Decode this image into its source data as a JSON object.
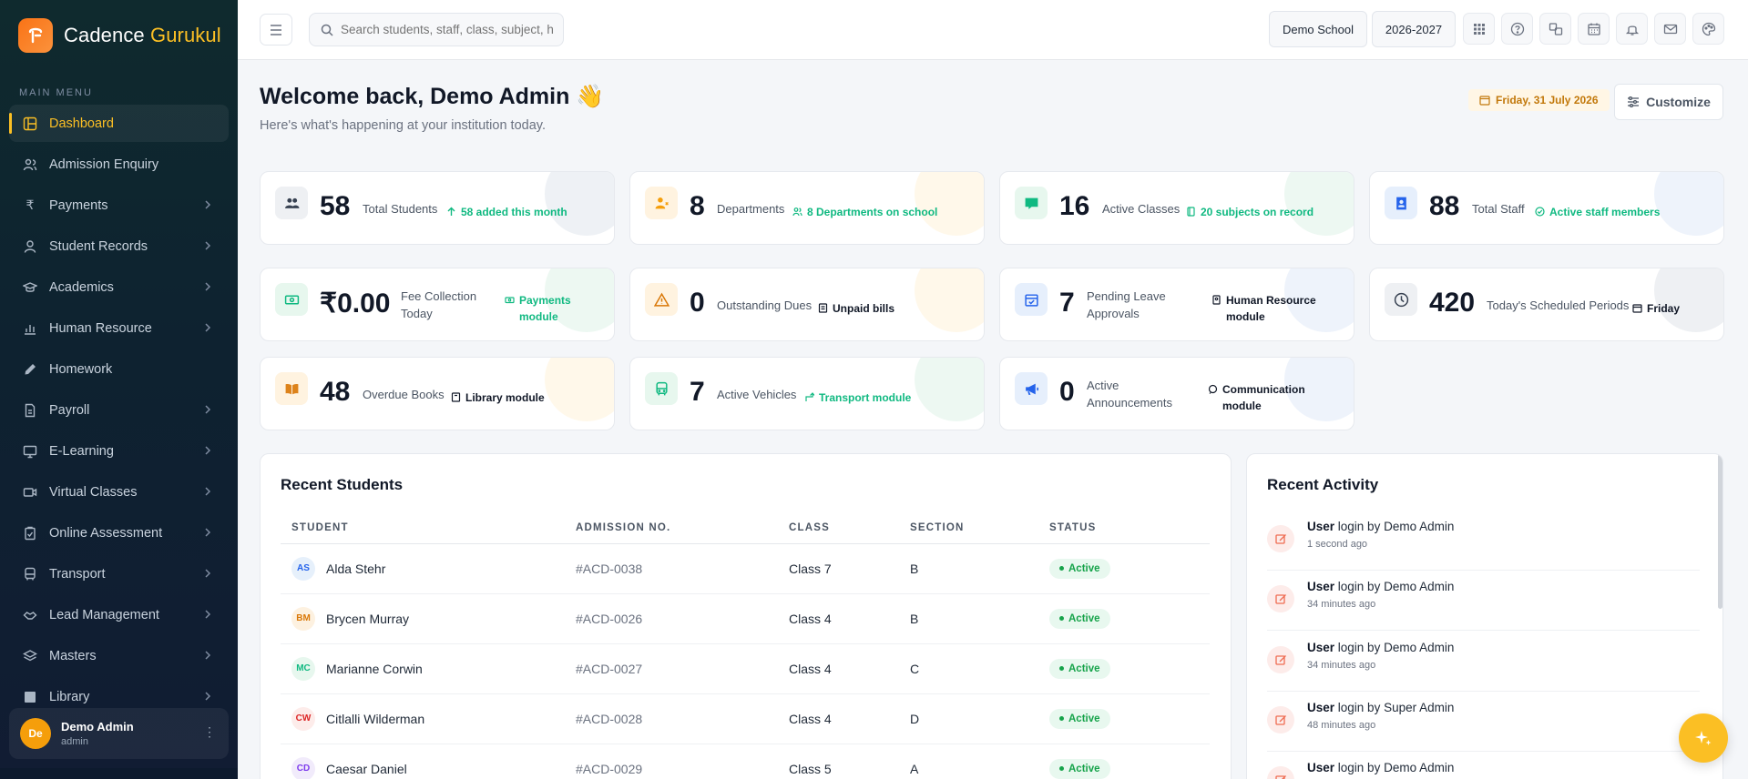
{
  "brand": {
    "name_main": "Cadence",
    "name_accent": "Gurukul"
  },
  "sidebar": {
    "heading": "MAIN MENU",
    "items": [
      {
        "label": "Dashboard",
        "icon": "dashboard-icon",
        "active": true
      },
      {
        "label": "Admission Enquiry",
        "icon": "users-icon"
      },
      {
        "label": "Payments",
        "icon": "rupee-icon",
        "chevron": true
      },
      {
        "label": "Student Records",
        "icon": "student-icon",
        "chevron": true
      },
      {
        "label": "Academics",
        "icon": "graduation-cap-icon",
        "chevron": true
      },
      {
        "label": "Human Resource",
        "icon": "bar-chart-icon",
        "chevron": true
      },
      {
        "label": "Homework",
        "icon": "pencil-icon"
      },
      {
        "label": "Payroll",
        "icon": "document-icon",
        "chevron": true
      },
      {
        "label": "E-Learning",
        "icon": "monitor-icon",
        "chevron": true
      },
      {
        "label": "Virtual Classes",
        "icon": "video-icon",
        "chevron": true
      },
      {
        "label": "Online Assessment",
        "icon": "clipboard-icon",
        "chevron": true
      },
      {
        "label": "Transport",
        "icon": "bus-icon",
        "chevron": true
      },
      {
        "label": "Lead Management",
        "icon": "handshake-icon",
        "chevron": true
      },
      {
        "label": "Masters",
        "icon": "layers-icon",
        "chevron": true
      },
      {
        "label": "Library",
        "icon": "book-icon",
        "chevron": true
      }
    ],
    "user": {
      "initials": "De",
      "name": "Demo Admin",
      "role": "admin"
    }
  },
  "topbar": {
    "search_placeholder": "Search students, staff, class, subject, h",
    "school": "Demo School",
    "year": "2026-2027"
  },
  "main": {
    "welcome": "Welcome back, Demo Admin 👋",
    "subtitle": "Here's what's happening at your institution today.",
    "date": "Friday, 31 July 2026",
    "customize": "Customize"
  },
  "stats": [
    {
      "value": "58",
      "label": "Total Students",
      "note": "58 added this month"
    },
    {
      "value": "8",
      "label": "Departments",
      "note": "8 Departments on school"
    },
    {
      "value": "16",
      "label": "Active Classes",
      "note": "20 subjects on record"
    },
    {
      "value": "88",
      "label": "Total Staff",
      "note": "Active staff members"
    },
    {
      "value": "₹0.00",
      "label": "Fee Collection Today",
      "note": "Payments module"
    },
    {
      "value": "0",
      "label": "Outstanding Dues",
      "note": "Unpaid bills"
    },
    {
      "value": "7",
      "label": "Pending Leave Approvals",
      "note": "Human Resource module"
    },
    {
      "value": "420",
      "label": "Today's Scheduled Periods",
      "note": "Friday"
    },
    {
      "value": "48",
      "label": "Overdue Books",
      "note": "Library module"
    },
    {
      "value": "7",
      "label": "Active Vehicles",
      "note": "Transport module"
    },
    {
      "value": "0",
      "label": "Active Announcements",
      "note": "Communication module"
    }
  ],
  "recent_students": {
    "title": "Recent Students",
    "columns": [
      "STUDENT",
      "ADMISSION NO.",
      "CLASS",
      "SECTION",
      "STATUS"
    ],
    "rows": [
      {
        "initials": "AS",
        "name": "Alda Stehr",
        "admission": "#ACD-0038",
        "class": "Class 7",
        "section": "B",
        "status": "Active"
      },
      {
        "initials": "BM",
        "name": "Brycen Murray",
        "admission": "#ACD-0026",
        "class": "Class 4",
        "section": "B",
        "status": "Active"
      },
      {
        "initials": "MC",
        "name": "Marianne Corwin",
        "admission": "#ACD-0027",
        "class": "Class 4",
        "section": "C",
        "status": "Active"
      },
      {
        "initials": "CW",
        "name": "Citlalli Wilderman",
        "admission": "#ACD-0028",
        "class": "Class 4",
        "section": "D",
        "status": "Active"
      },
      {
        "initials": "CD",
        "name": "Caesar Daniel",
        "admission": "#ACD-0029",
        "class": "Class 5",
        "section": "A",
        "status": "Active"
      }
    ]
  },
  "recent_activity": {
    "title": "Recent Activity",
    "items": [
      {
        "user": "User",
        "text": " login by Demo Admin",
        "time": "1 second ago"
      },
      {
        "user": "User",
        "text": " login by Demo Admin",
        "time": "34 minutes ago"
      },
      {
        "user": "User",
        "text": " login by Demo Admin",
        "time": "34 minutes ago"
      },
      {
        "user": "User",
        "text": " login by Super Admin",
        "time": "48 minutes ago"
      },
      {
        "user": "User",
        "text": " login by Demo Admin",
        "time": ""
      }
    ]
  }
}
